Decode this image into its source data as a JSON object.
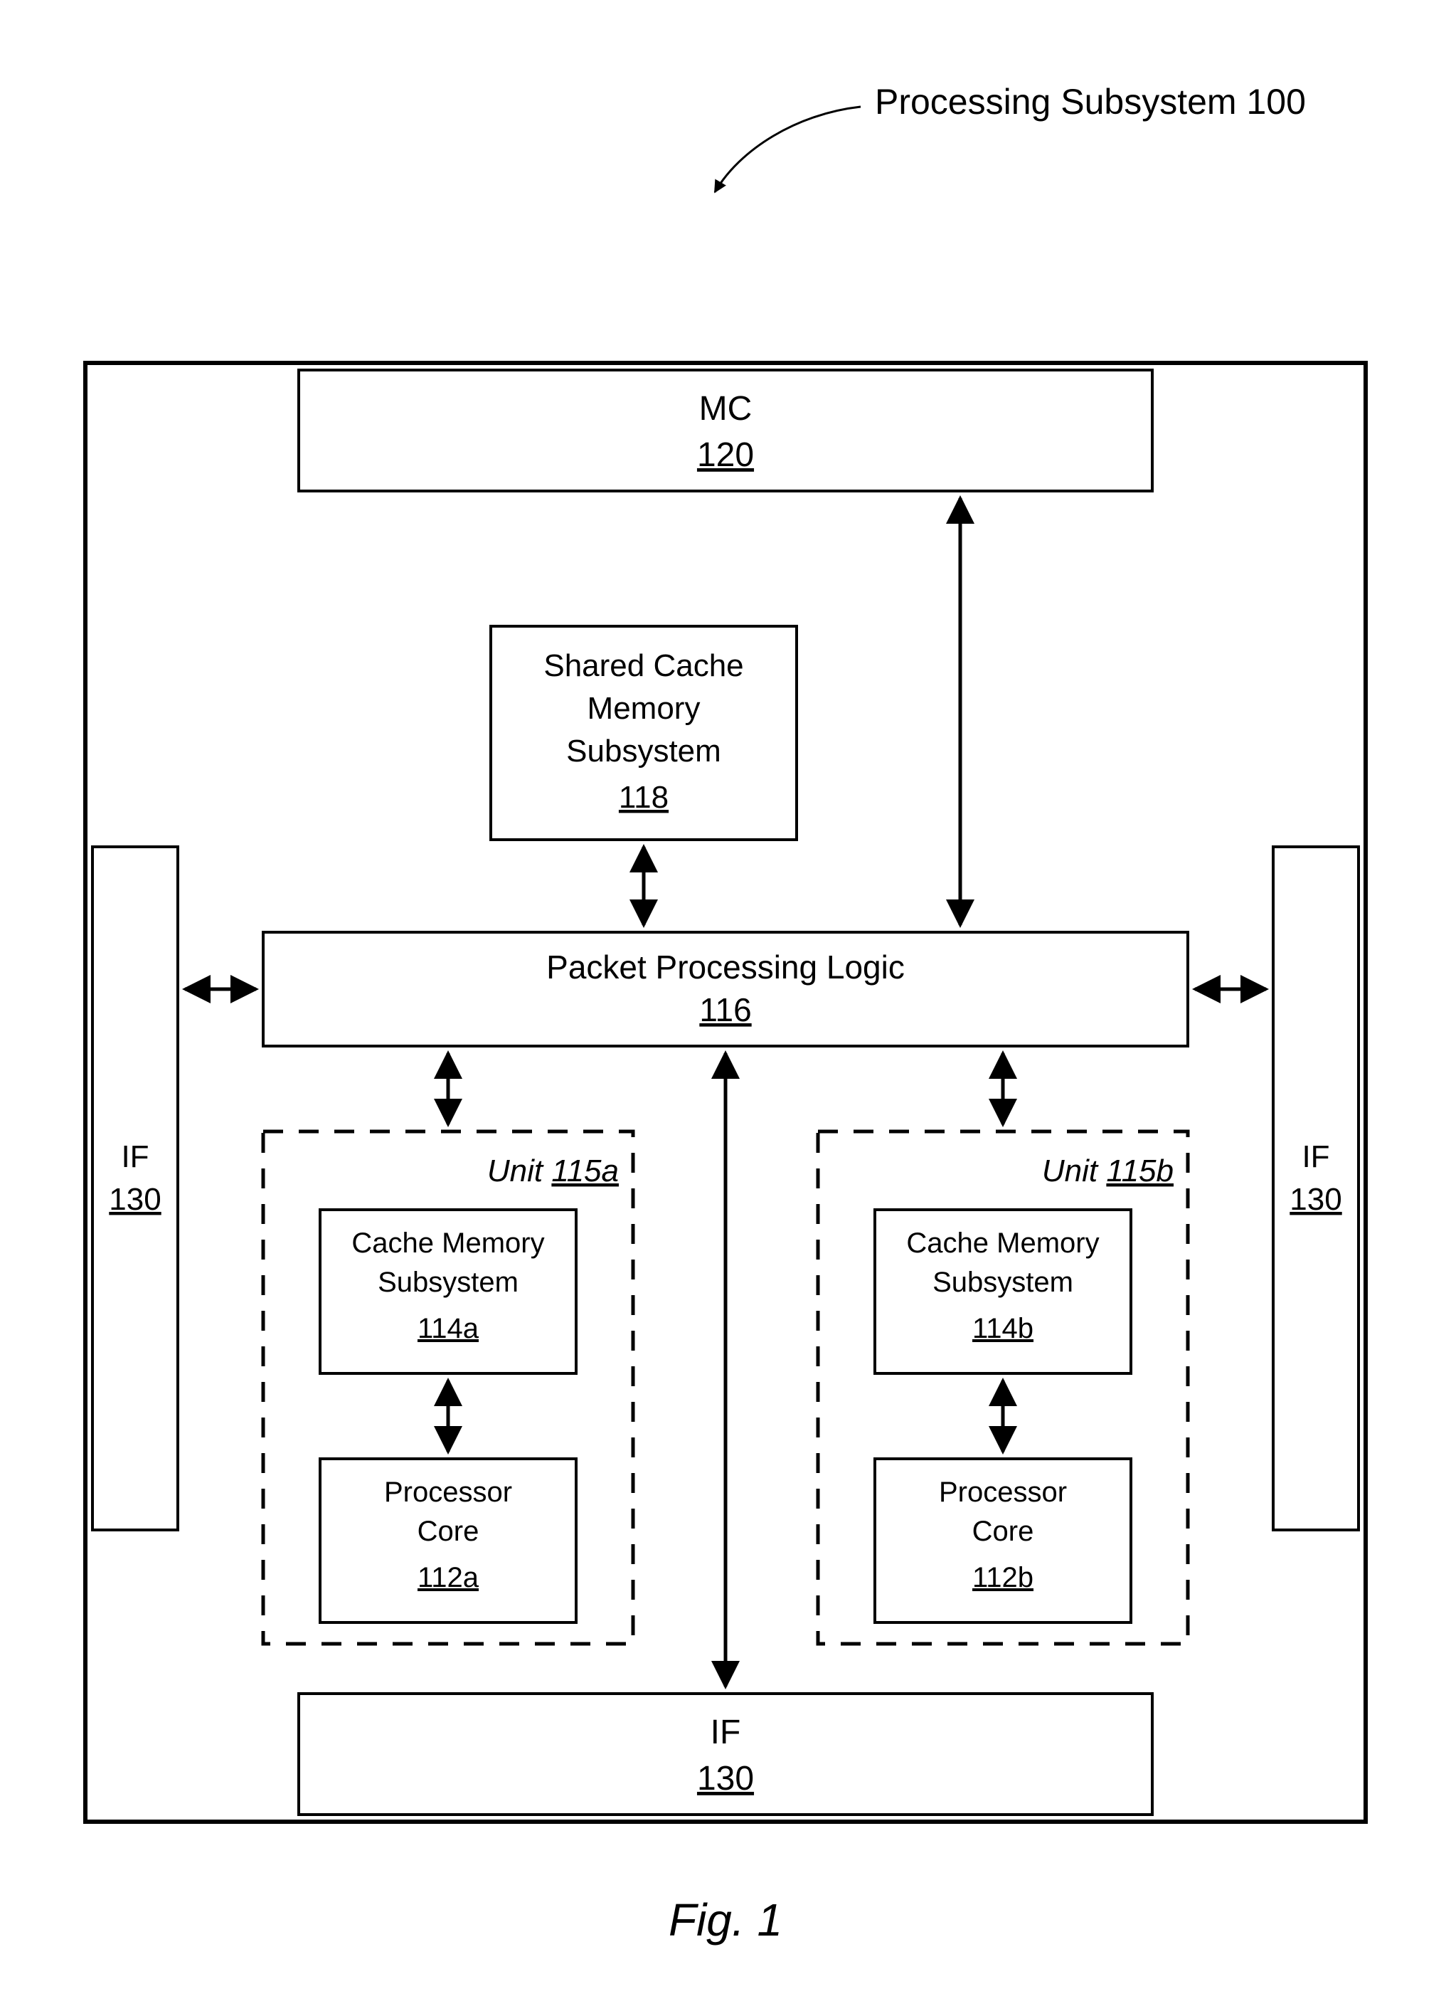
{
  "title": {
    "text": "Processing Subsystem",
    "ref": "100"
  },
  "fig_caption": "Fig. 1",
  "mc": {
    "label": "MC",
    "ref": "120"
  },
  "if_left": {
    "label": "IF",
    "ref": "130"
  },
  "if_right": {
    "label": "IF",
    "ref": "130"
  },
  "if_bottom": {
    "label": "IF",
    "ref": "130"
  },
  "shared_cache": {
    "line1": "Shared Cache",
    "line2": "Memory",
    "line3": "Subsystem",
    "ref": "118"
  },
  "ppl": {
    "label": "Packet Processing Logic",
    "ref": "116"
  },
  "unit_a": {
    "label": "Unit",
    "ref": "115a"
  },
  "unit_b": {
    "label": "Unit",
    "ref": "115b"
  },
  "cache_a": {
    "line1": "Cache Memory",
    "line2": "Subsystem",
    "ref": "114a"
  },
  "cache_b": {
    "line1": "Cache Memory",
    "line2": "Subsystem",
    "ref": "114b"
  },
  "core_a": {
    "line1": "Processor",
    "line2": "Core",
    "ref": "112a"
  },
  "core_b": {
    "line1": "Processor",
    "line2": "Core",
    "ref": "112b"
  }
}
